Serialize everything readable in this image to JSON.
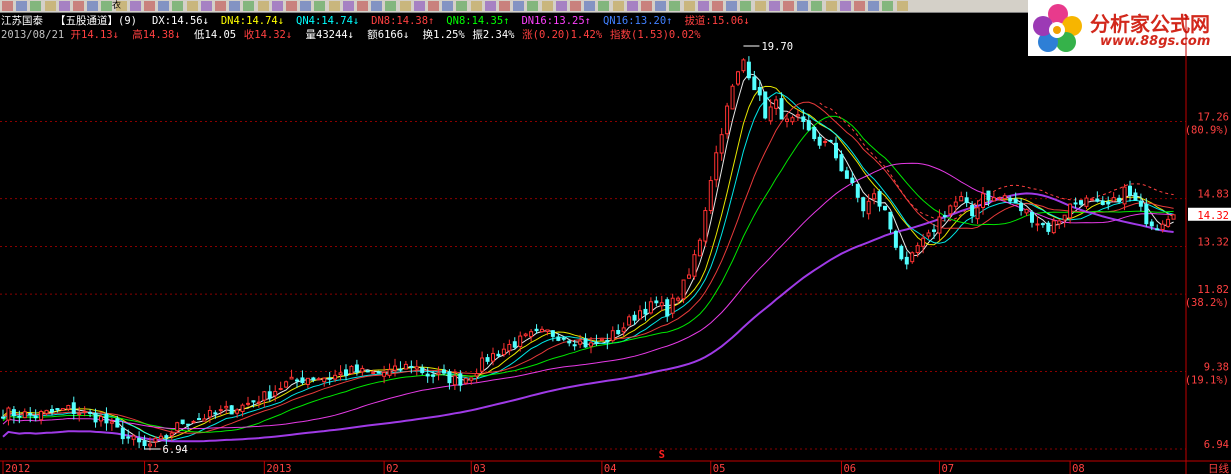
{
  "toolbar": {
    "icons": [
      "edit-icon",
      "dropdown-icon",
      "table-icon",
      "dropdown-icon",
      "color-icon",
      "color-icon",
      "color-icon",
      "color-icon",
      "color-icon",
      "color-icon",
      "color-icon",
      "color-icon",
      "color-icon",
      "color-icon",
      "color-icon",
      "color-icon",
      "color-icon",
      "color-icon",
      "color-icon",
      "color-icon",
      "color-icon",
      "color-icon",
      "color-icon",
      "color-icon",
      "color-icon",
      "color-icon",
      "color-icon",
      "color-icon",
      "color-icon",
      "color-icon",
      "color-icon",
      "color-icon",
      "color-icon",
      "color-icon",
      "color-icon",
      "color-icon",
      "color-icon",
      "color-icon",
      "color-icon",
      "pointer-icon",
      "select-icon",
      "line-icon",
      "line-icon",
      "line-icon",
      "line-icon",
      "chart-icon",
      "chart-icon",
      "chart-icon",
      "chart-icon",
      "grid-icon",
      "grid-icon",
      "grid-icon",
      "grid-icon",
      "text-icon",
      "text-icon",
      "label-icon",
      "up-arrow-icon",
      "down-arrow-icon",
      "fork-icon",
      "block-icon",
      "block-icon",
      "clear-icon",
      "save-icon",
      "dropdown-icon"
    ],
    "dropdown_label": "衣"
  },
  "logo": {
    "text": "分析家公式网",
    "url": "www.88gs.com"
  },
  "header": {
    "row1": [
      {
        "text": "江苏国泰",
        "color": "#ffffff"
      },
      {
        "text": "【五股通道】(9)",
        "color": "#ffffff"
      },
      {
        "text": "DX:14.56↓",
        "color": "#ffffff"
      },
      {
        "text": "DN4:14.74↓",
        "color": "#ffff00"
      },
      {
        "text": "QN4:14.74↓",
        "color": "#00ffff"
      },
      {
        "text": "DN8:14.38↑",
        "color": "#ff4040"
      },
      {
        "text": "QN8:14.35↑",
        "color": "#00ff00"
      },
      {
        "text": "DN16:13.25↑",
        "color": "#ff40ff"
      },
      {
        "text": "QN16:13.20↑",
        "color": "#4080ff"
      },
      {
        "text": "拔道:15.06↓",
        "color": "#ff4040"
      }
    ],
    "row2": [
      {
        "text": "2013/08/21",
        "color": "#c0c0c0"
      },
      {
        "text": "开14.13↓",
        "color": "#ff4040"
      },
      {
        "text": "高14.38↓",
        "color": "#ff4040"
      },
      {
        "text": "低14.05",
        "color": "#ffffff"
      },
      {
        "text": "收14.32↓",
        "color": "#ff4040"
      },
      {
        "text": "量43244↓",
        "color": "#ffffff"
      },
      {
        "text": "额6166↓",
        "color": "#ffffff"
      },
      {
        "text": "换1.25%",
        "color": "#ffffff"
      },
      {
        "text": "振2.34%",
        "color": "#ffffff"
      },
      {
        "text": "涨(0.20)1.42%",
        "color": "#ff4040"
      },
      {
        "text": "指数(1.53)0.02%",
        "color": "#ff4040"
      }
    ]
  },
  "chart_data": {
    "type": "candlestick",
    "title": "江苏国泰",
    "ylim": [
      6.94,
      19.7
    ],
    "y_ticks": [
      {
        "value": 17.26,
        "label": "17.26",
        "pct": "(80.9%)"
      },
      {
        "value": 14.83,
        "label": "14.83",
        "pct": ""
      },
      {
        "value": 13.32,
        "label": "13.32",
        "pct": ""
      },
      {
        "value": 11.82,
        "label": "11.82",
        "pct": "(38.2%)"
      },
      {
        "value": 9.38,
        "label": "9.38",
        "pct": "(19.1%)"
      },
      {
        "value": 6.94,
        "label": "6.94",
        "pct": ""
      }
    ],
    "x_ticks": [
      {
        "label": "2012",
        "index": 0
      },
      {
        "label": "12",
        "index": 26
      },
      {
        "label": "2013",
        "index": 48
      },
      {
        "label": "02",
        "index": 70
      },
      {
        "label": "03",
        "index": 86
      },
      {
        "label": "04",
        "index": 110
      },
      {
        "label": "05",
        "index": 130
      },
      {
        "label": "06",
        "index": 154
      },
      {
        "label": "07",
        "index": 172
      },
      {
        "label": "08",
        "index": 196
      }
    ],
    "current_price": "14.32",
    "high_label": "19.70",
    "low_label": "6.94",
    "period_label": "日线",
    "marker_label": "S",
    "marker_index": 121,
    "colors": {
      "up": "#ff3232",
      "down": "#54ffff",
      "grid": "#8b0000",
      "axis": "#c00000"
    },
    "overlays": [
      {
        "name": "DX",
        "color": "#ffffff"
      },
      {
        "name": "DN4",
        "color": "#ffff00"
      },
      {
        "name": "QN4",
        "color": "#00ffff"
      },
      {
        "name": "DN8",
        "color": "#ff4040"
      },
      {
        "name": "QN8",
        "color": "#00ff00"
      },
      {
        "name": "DN16",
        "color": "#ff40ff"
      },
      {
        "name": "QN16",
        "color": "#4080ff"
      },
      {
        "name": "拔道",
        "color": "#ff4040"
      }
    ],
    "close_path": [
      [
        0,
        8.1
      ],
      [
        6,
        8.0
      ],
      [
        12,
        8.2
      ],
      [
        18,
        7.9
      ],
      [
        22,
        7.4
      ],
      [
        26,
        7.0
      ],
      [
        29,
        7.2
      ],
      [
        33,
        7.8
      ],
      [
        38,
        8.0
      ],
      [
        44,
        8.3
      ],
      [
        48,
        8.6
      ],
      [
        52,
        9.0
      ],
      [
        56,
        9.2
      ],
      [
        60,
        9.2
      ],
      [
        64,
        9.4
      ],
      [
        68,
        9.3
      ],
      [
        72,
        9.4
      ],
      [
        75,
        9.6
      ],
      [
        78,
        9.3
      ],
      [
        81,
        9.2
      ],
      [
        84,
        9.1
      ],
      [
        86,
        9.3
      ],
      [
        89,
        9.8
      ],
      [
        93,
        10.2
      ],
      [
        97,
        10.5
      ],
      [
        100,
        10.6
      ],
      [
        103,
        10.5
      ],
      [
        106,
        10.3
      ],
      [
        108,
        10.2
      ],
      [
        111,
        10.4
      ],
      [
        114,
        10.8
      ],
      [
        117,
        11.3
      ],
      [
        120,
        11.5
      ],
      [
        122,
        11.3
      ],
      [
        124,
        11.8
      ],
      [
        126,
        12.4
      ],
      [
        128,
        13.6
      ],
      [
        130,
        15.5
      ],
      [
        132,
        17.0
      ],
      [
        134,
        18.3
      ],
      [
        136,
        19.2
      ],
      [
        138,
        18.4
      ],
      [
        140,
        17.5
      ],
      [
        142,
        17.8
      ],
      [
        144,
        17.2
      ],
      [
        146,
        17.3
      ],
      [
        148,
        16.9
      ],
      [
        150,
        16.6
      ],
      [
        152,
        16.5
      ],
      [
        154,
        15.8
      ],
      [
        156,
        15.2
      ],
      [
        158,
        14.5
      ],
      [
        160,
        14.9
      ],
      [
        162,
        14.4
      ],
      [
        164,
        13.4
      ],
      [
        166,
        12.6
      ],
      [
        168,
        13.3
      ],
      [
        170,
        13.6
      ],
      [
        172,
        14.2
      ],
      [
        174,
        14.6
      ],
      [
        176,
        14.8
      ],
      [
        178,
        14.3
      ],
      [
        180,
        15.0
      ],
      [
        182,
        14.8
      ],
      [
        184,
        14.9
      ],
      [
        186,
        14.6
      ],
      [
        188,
        14.4
      ],
      [
        190,
        14.1
      ],
      [
        192,
        13.9
      ],
      [
        194,
        14.2
      ],
      [
        196,
        14.6
      ],
      [
        198,
        14.8
      ],
      [
        200,
        14.7
      ],
      [
        202,
        14.5
      ],
      [
        204,
        14.7
      ],
      [
        206,
        15.1
      ],
      [
        208,
        14.7
      ],
      [
        210,
        14.2
      ],
      [
        212,
        14.0
      ],
      [
        214,
        14.32
      ]
    ]
  }
}
